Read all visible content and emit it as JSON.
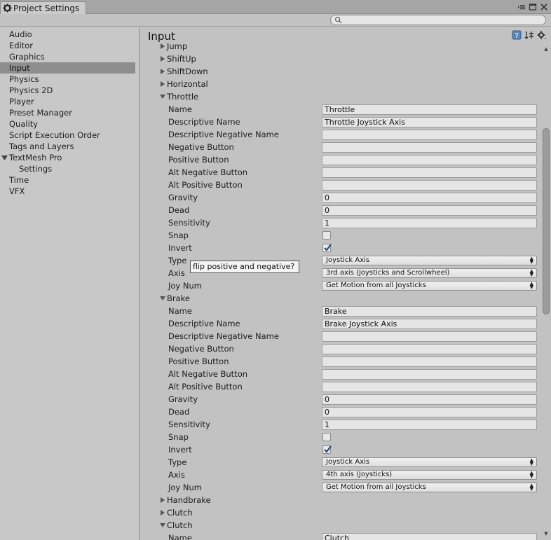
{
  "window": {
    "tab_title": "Project Settings",
    "search": {
      "placeholder": "",
      "value": ""
    }
  },
  "sidebar": {
    "items": [
      {
        "label": "Audio",
        "selected": false
      },
      {
        "label": "Editor",
        "selected": false
      },
      {
        "label": "Graphics",
        "selected": false
      },
      {
        "label": "Input",
        "selected": true
      },
      {
        "label": "Physics",
        "selected": false
      },
      {
        "label": "Physics 2D",
        "selected": false
      },
      {
        "label": "Player",
        "selected": false
      },
      {
        "label": "Preset Manager",
        "selected": false
      },
      {
        "label": "Quality",
        "selected": false
      },
      {
        "label": "Script Execution Order",
        "selected": false
      },
      {
        "label": "Tags and Layers",
        "selected": false
      },
      {
        "label": "TextMesh Pro",
        "selected": false,
        "expanded": true
      },
      {
        "label": "Settings",
        "selected": false,
        "child": true
      },
      {
        "label": "Time",
        "selected": false
      },
      {
        "label": "VFX",
        "selected": false
      }
    ]
  },
  "main": {
    "title": "Input",
    "collapsed_axes": [
      "Jump",
      "ShiftUp",
      "ShiftDown",
      "Horizontal"
    ],
    "throttle": {
      "header": "Throttle",
      "labels": {
        "name": "Name",
        "descriptive_name": "Descriptive Name",
        "descriptive_negative_name": "Descriptive Negative Name",
        "negative_button": "Negative Button",
        "positive_button": "Positive Button",
        "alt_negative_button": "Alt Negative Button",
        "alt_positive_button": "Alt Positive Button",
        "gravity": "Gravity",
        "dead": "Dead",
        "sensitivity": "Sensitivity",
        "snap": "Snap",
        "invert": "Invert",
        "type": "Type",
        "axis": "Axis",
        "joy_num": "Joy Num"
      },
      "values": {
        "name": "Throttle",
        "descriptive_name": "Throttle Joystick Axis",
        "descriptive_negative_name": "",
        "negative_button": "",
        "positive_button": "",
        "alt_negative_button": "",
        "alt_positive_button": "",
        "gravity": "0",
        "dead": "0",
        "sensitivity": "1",
        "snap": false,
        "invert": true,
        "type": "Joystick Axis",
        "axis": "3rd axis (Joysticks and Scrollwheel)",
        "joy_num": "Get Motion from all Joysticks"
      },
      "tooltip": "flip positive and negative?"
    },
    "brake": {
      "header": "Brake",
      "labels": {
        "name": "Name",
        "descriptive_name": "Descriptive Name",
        "descriptive_negative_name": "Descriptive Negative Name",
        "negative_button": "Negative Button",
        "positive_button": "Positive Button",
        "alt_negative_button": "Alt Negative Button",
        "alt_positive_button": "Alt Positive Button",
        "gravity": "Gravity",
        "dead": "Dead",
        "sensitivity": "Sensitivity",
        "snap": "Snap",
        "invert": "Invert",
        "type": "Type",
        "axis": "Axis",
        "joy_num": "Joy Num"
      },
      "values": {
        "name": "Brake",
        "descriptive_name": "Brake Joystick Axis",
        "descriptive_negative_name": "",
        "negative_button": "",
        "positive_button": "",
        "alt_negative_button": "",
        "alt_positive_button": "",
        "gravity": "0",
        "dead": "0",
        "sensitivity": "1",
        "snap": false,
        "invert": true,
        "type": "Joystick Axis",
        "axis": "4th axis (Joysticks)",
        "joy_num": "Get Motion from all Joysticks"
      }
    },
    "handbrake_header": "Handbrake",
    "clutch_collapsed_header": "Clutch",
    "clutch": {
      "header": "Clutch",
      "name_label": "Name",
      "name_value": "Clutch"
    }
  },
  "icons": {
    "tab": "gear-icon",
    "search": "search-icon",
    "header": [
      "help-icon",
      "preset-icon",
      "settings-gear-icon"
    ],
    "window": [
      "menu-icon",
      "maximize-icon",
      "close-icon"
    ]
  }
}
